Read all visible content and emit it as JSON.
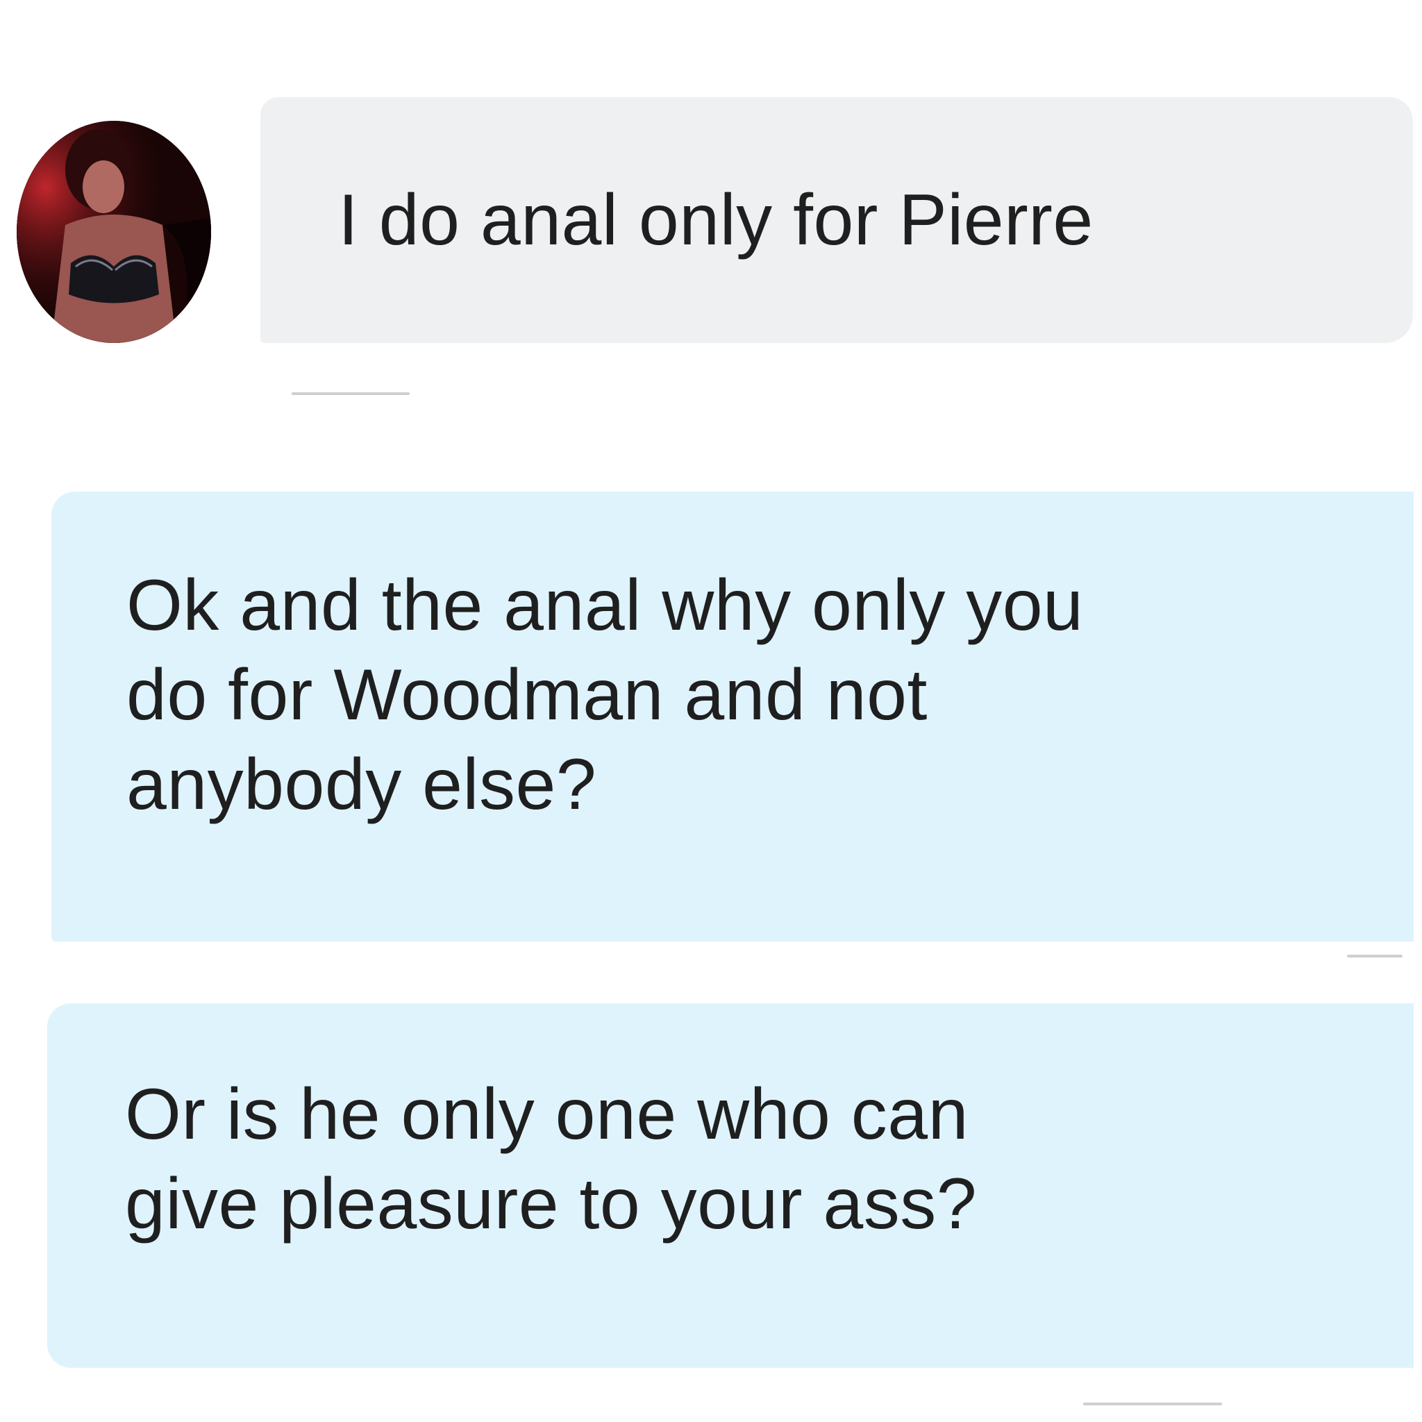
{
  "conversation": {
    "messages": [
      {
        "direction": "incoming",
        "text": "I do anal only for Pierre",
        "has_avatar": true,
        "avatar_icon": "contact-avatar-photo"
      },
      {
        "direction": "outgoing",
        "text": "Ok and the anal why only you\ndo for Woodman and not\nanybody else?"
      },
      {
        "direction": "outgoing",
        "text": "Or is he only one who can\ngive pleasure to your ass?"
      }
    ]
  },
  "colors": {
    "incoming_bubble": "#eef0f2",
    "outgoing_bubble": "#dff3fd",
    "text": "#1f1f1f",
    "background": "#ffffff"
  }
}
